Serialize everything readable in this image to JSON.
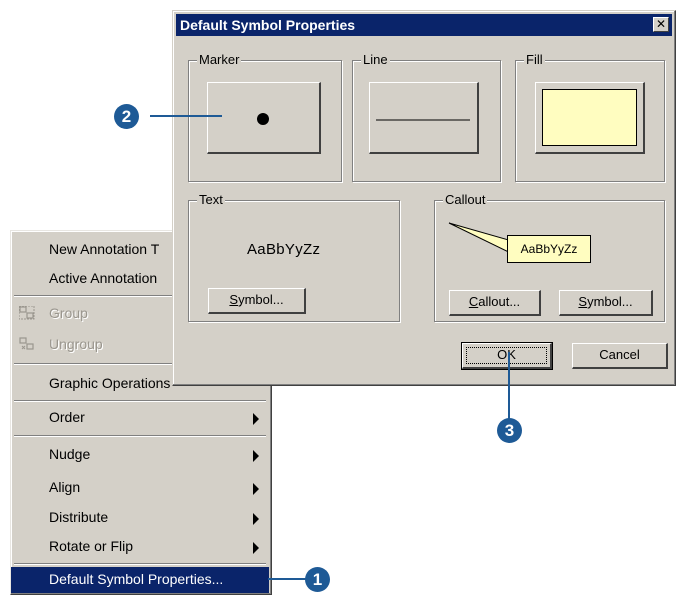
{
  "context_menu": {
    "items": [
      {
        "label": "New Annotation T",
        "icon": "",
        "disabled": false,
        "submenu": false
      },
      {
        "label": "Active Annotation",
        "icon": "",
        "disabled": false,
        "submenu": false
      },
      {
        "label": "Group",
        "icon": "group-icon",
        "disabled": true,
        "submenu": false
      },
      {
        "label": "Ungroup",
        "icon": "ungroup-icon",
        "disabled": true,
        "submenu": false
      },
      {
        "label": "Graphic Operations",
        "icon": "",
        "disabled": false,
        "submenu": false
      },
      {
        "label": "Order",
        "icon": "",
        "disabled": false,
        "submenu": true
      },
      {
        "label": "Nudge",
        "icon": "",
        "disabled": false,
        "submenu": true
      },
      {
        "label": "Align",
        "icon": "",
        "disabled": false,
        "submenu": true
      },
      {
        "label": "Distribute",
        "icon": "",
        "disabled": false,
        "submenu": true
      },
      {
        "label": "Rotate or Flip",
        "icon": "",
        "disabled": false,
        "submenu": true
      },
      {
        "label": "Default Symbol Properties...",
        "icon": "",
        "disabled": false,
        "submenu": false,
        "selected": true
      }
    ]
  },
  "dialog": {
    "title": "Default Symbol Properties",
    "close_glyph": "✕",
    "marker": {
      "label": "Marker"
    },
    "line": {
      "label": "Line"
    },
    "fill": {
      "label": "Fill",
      "swatch_color": "#fffdc0"
    },
    "text": {
      "label": "Text",
      "sample": "AaBbYyZz",
      "symbol_button": {
        "pre": "",
        "accel": "S",
        "post": "ymbol..."
      }
    },
    "callout": {
      "label": "Callout",
      "sample": "AaBbYyZz",
      "callout_button": {
        "pre": "",
        "accel": "C",
        "post": "allout..."
      },
      "symbol_button": {
        "pre": "",
        "accel": "S",
        "post": "ymbol..."
      }
    },
    "ok_button": "OK",
    "cancel_button": "Cancel"
  },
  "steps": {
    "one": "1",
    "two": "2",
    "three": "3"
  },
  "colors": {
    "accent": "#1e5a96",
    "selection": "#0a246a",
    "face": "#d4d0c8"
  }
}
